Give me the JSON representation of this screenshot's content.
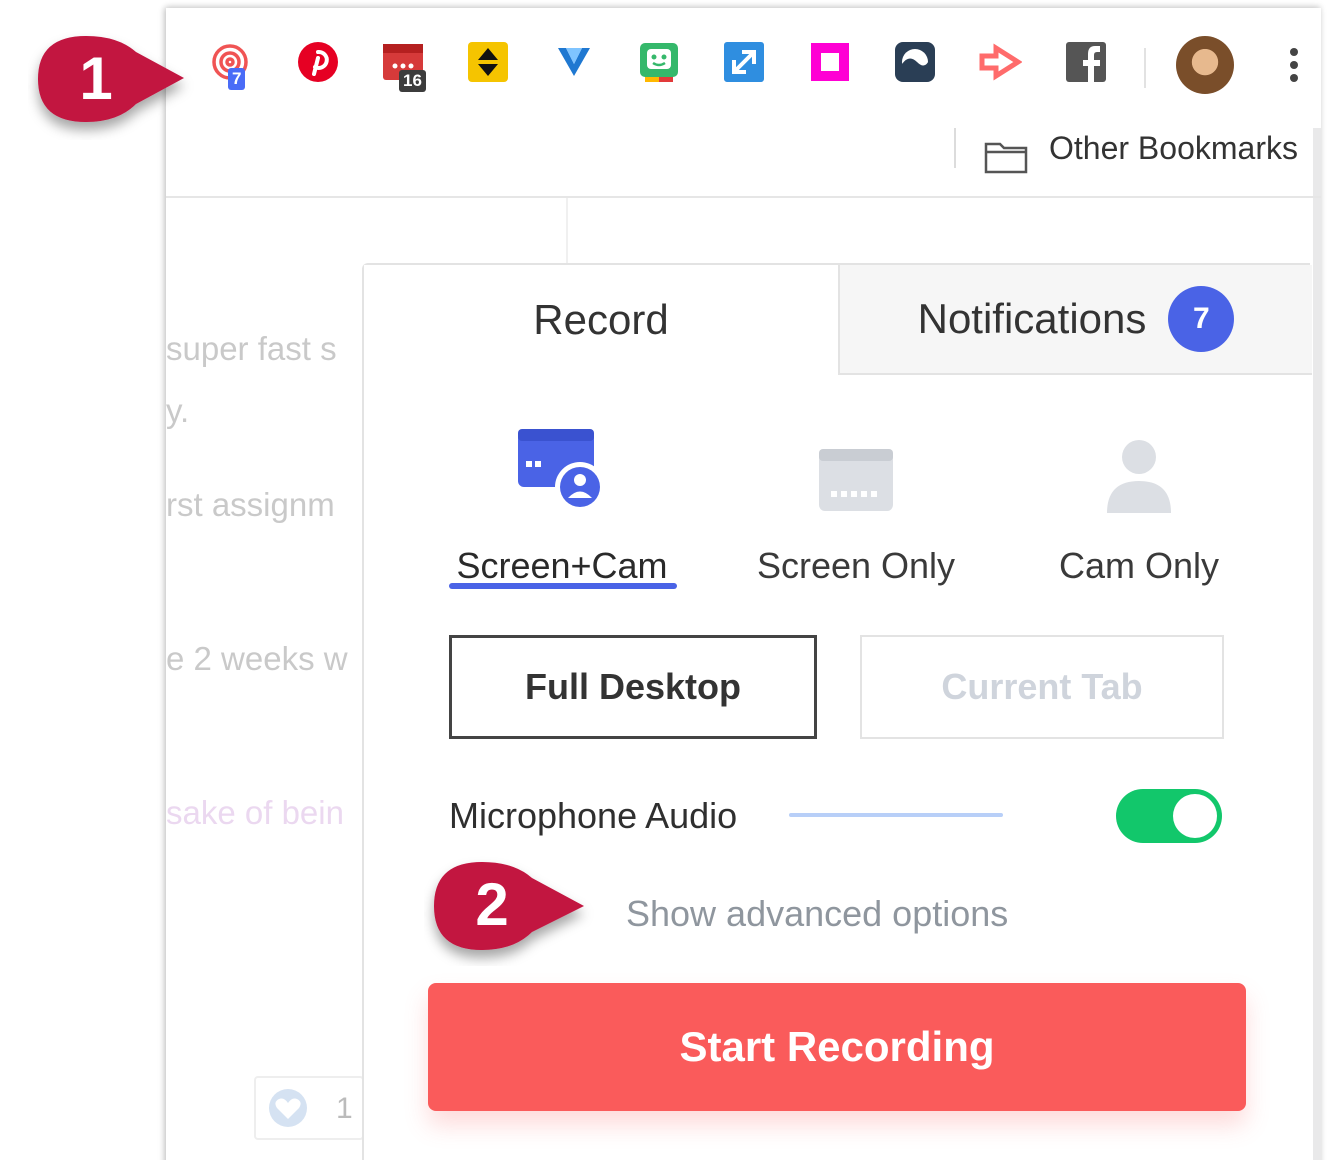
{
  "toolbar": {
    "extensions": [
      {
        "name": "loom-icon",
        "badge": "7",
        "color": "#f05454"
      },
      {
        "name": "pinterest-icon",
        "color": "#e60023"
      },
      {
        "name": "calendar-icon",
        "badge": "16",
        "color": "#d63a3a"
      },
      {
        "name": "sort-arrows-icon",
        "color": "#f5c400"
      },
      {
        "name": "y-app-icon",
        "color": "#1f78d1"
      },
      {
        "name": "chat-robot-icon",
        "color": "#35b86b"
      },
      {
        "name": "expand-arrow-icon",
        "color": "#2f8ee0"
      },
      {
        "name": "magenta-square-icon",
        "color": "#ff00d4"
      },
      {
        "name": "wave-icon",
        "color": "#2a3e55"
      },
      {
        "name": "arrow-right-icon",
        "color": "#ff6b6b"
      },
      {
        "name": "facebook-icon",
        "color": "#555555"
      }
    ],
    "avatar": "user-avatar",
    "menu": "kebab-menu-icon"
  },
  "bookmarks": {
    "other_label": "Other Bookmarks"
  },
  "background_page": {
    "line1": "super fast s",
    "line2": "y.",
    "line3": "rst assignm",
    "line4": "e 2 weeks w",
    "line5": "sake of bein",
    "like_count": "1"
  },
  "popup": {
    "tabs": {
      "record": "Record",
      "notifications": "Notifications",
      "notifications_count": "7"
    },
    "modes": {
      "screen_cam": "Screen+Cam",
      "screen_only": "Screen Only",
      "cam_only": "Cam Only",
      "selected": "Screen+Cam"
    },
    "capture": {
      "full_desktop": "Full Desktop",
      "current_tab": "Current Tab",
      "selected": "Full Desktop"
    },
    "microphone": {
      "label": "Microphone Audio",
      "enabled": true
    },
    "advanced_link": "Show advanced options",
    "start_button": "Start Recording"
  },
  "callouts": {
    "one": "1",
    "two": "2"
  },
  "colors": {
    "accent_blue": "#4a63e6",
    "start_red": "#fa5b5b",
    "toggle_green": "#12c76b",
    "callout_red": "#c2123f"
  }
}
